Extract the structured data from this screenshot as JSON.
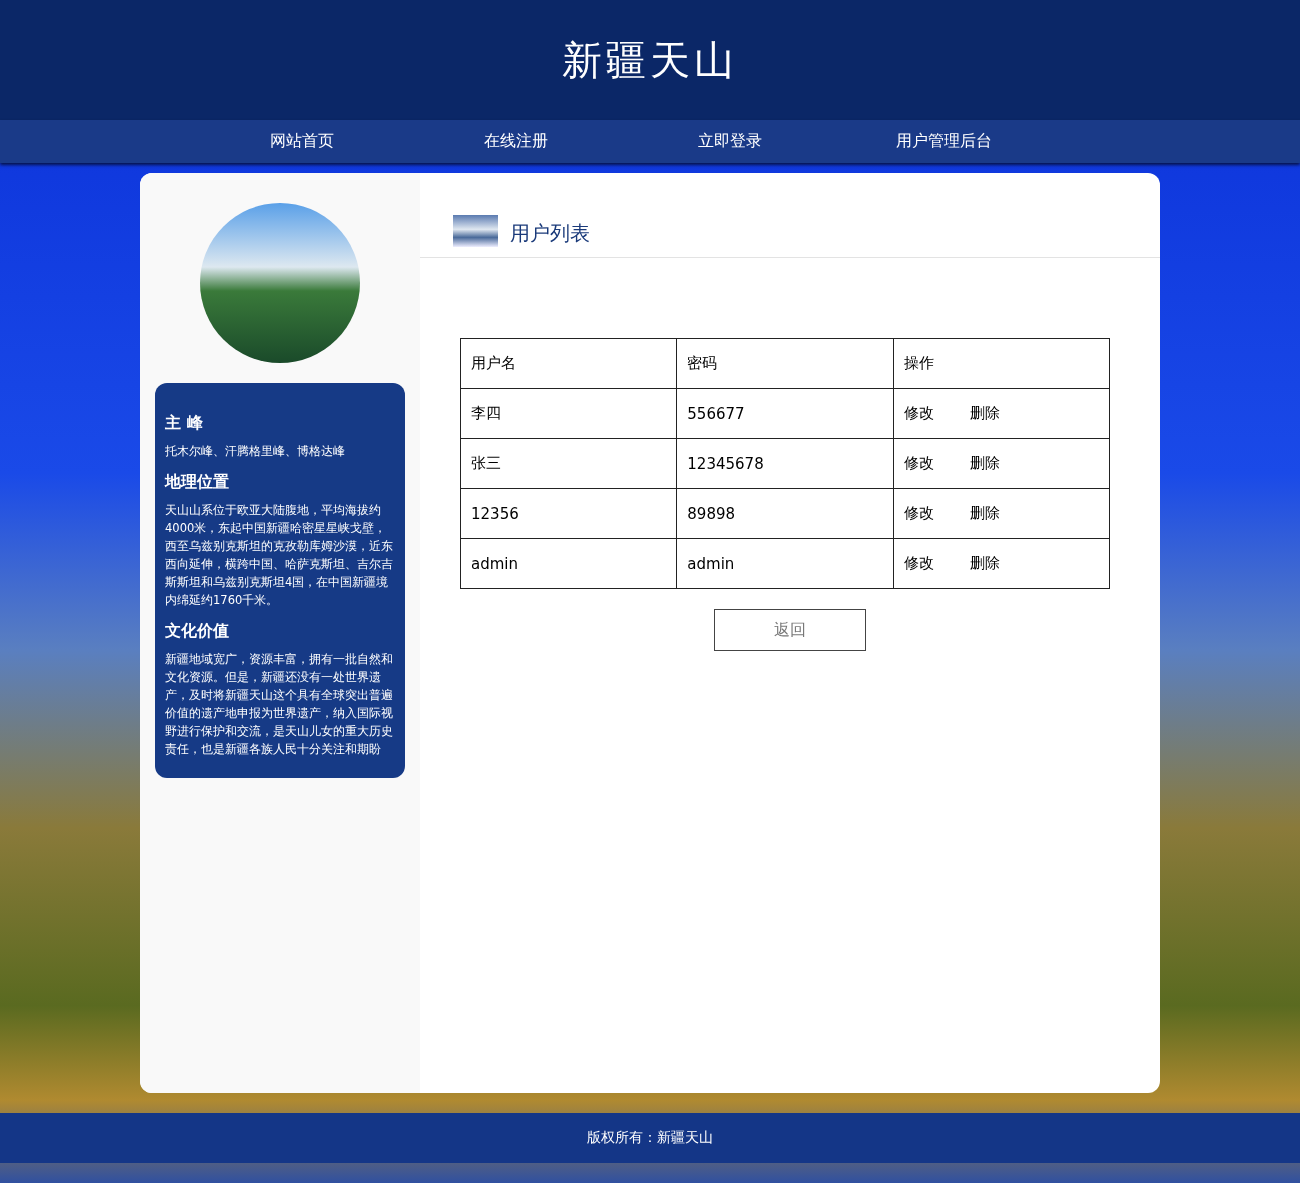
{
  "site_title": "新疆天山",
  "nav": [
    {
      "label": "网站首页"
    },
    {
      "label": "在线注册"
    },
    {
      "label": "立即登录"
    },
    {
      "label": "用户管理后台"
    }
  ],
  "sidebar": {
    "sections": [
      {
        "heading": "主 峰",
        "text": "托木尔峰、汗腾格里峰、博格达峰"
      },
      {
        "heading": "地理位置",
        "text": "天山山系位于欧亚大陆腹地，平均海拔约4000米，东起中国新疆哈密星星峡戈壁，西至乌兹别克斯坦的克孜勒库姆沙漠，近东西向延伸，横跨中国、哈萨克斯坦、吉尔吉斯斯坦和乌兹别克斯坦4国，在中国新疆境内绵延约1760千米。"
      },
      {
        "heading": "文化价值",
        "text": "新疆地域宽广，资源丰富，拥有一批自然和文化资源。但是，新疆还没有一处世界遗产，及时将新疆天山这个具有全球突出普遍价值的遗产地申报为世界遗产，纳入国际视野进行保护和交流，是天山儿女的重大历史责任，也是新疆各族人民十分关注和期盼"
      }
    ]
  },
  "panel_title": "用户列表",
  "table": {
    "columns": [
      "用户名",
      "密码",
      "操作"
    ],
    "rows": [
      {
        "username": "李四",
        "password": "556677",
        "actions": [
          "修改",
          "删除"
        ]
      },
      {
        "username": "张三",
        "password": "12345678",
        "actions": [
          "修改",
          "删除"
        ]
      },
      {
        "username": "12356",
        "password": "89898",
        "actions": [
          "修改",
          "删除"
        ]
      },
      {
        "username": "admin",
        "password": "admin",
        "actions": [
          "修改",
          "删除"
        ]
      }
    ]
  },
  "back_button": "返回",
  "footer": "版权所有：新疆天山"
}
